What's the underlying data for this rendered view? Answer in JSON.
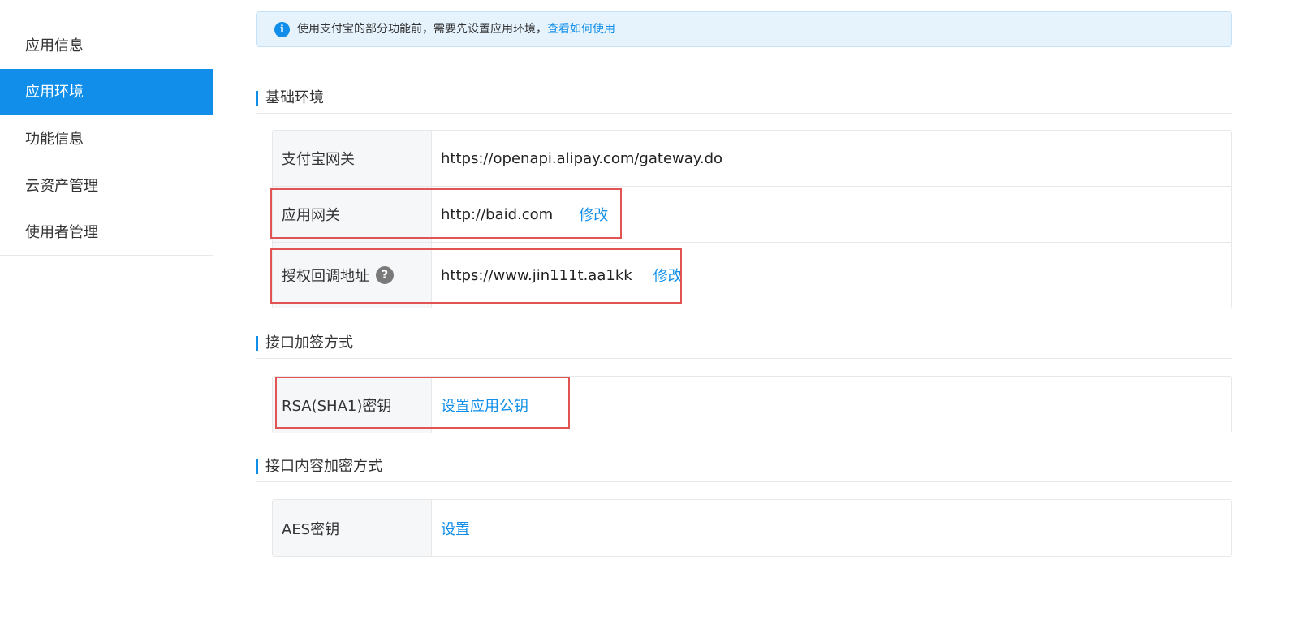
{
  "sidebar": {
    "items": [
      {
        "label": "应用信息",
        "active": false
      },
      {
        "label": "应用环境",
        "active": true
      },
      {
        "label": "功能信息",
        "active": false
      },
      {
        "label": "云资产管理",
        "active": false
      },
      {
        "label": "使用者管理",
        "active": false
      }
    ]
  },
  "notice": {
    "text": "使用支付宝的部分功能前，需要先设置应用环境，",
    "link": "查看如何使用",
    "icon": "info-icon"
  },
  "sections": [
    {
      "title": "基础环境",
      "rows": [
        {
          "label": "支付宝网关",
          "value": "https://openapi.alipay.com/gateway.do"
        },
        {
          "label": "应用网关",
          "value": "http://baid.com",
          "action": "修改"
        },
        {
          "label": "授权回调地址",
          "value": "https://www.jin111t.aa1kk",
          "action": "修改",
          "help": "?"
        }
      ]
    },
    {
      "title": "接口加签方式",
      "rows": [
        {
          "label": "RSA(SHA1)密钥",
          "action": "设置应用公钥"
        }
      ]
    },
    {
      "title": "接口内容加密方式",
      "rows": [
        {
          "label": "AES密钥",
          "action": "设置"
        }
      ]
    }
  ],
  "colors": {
    "accent": "#108ee9",
    "highlight_border": "#e05454",
    "label_bg": "#f6f7f9",
    "notice_bg": "#e6f3fd"
  }
}
